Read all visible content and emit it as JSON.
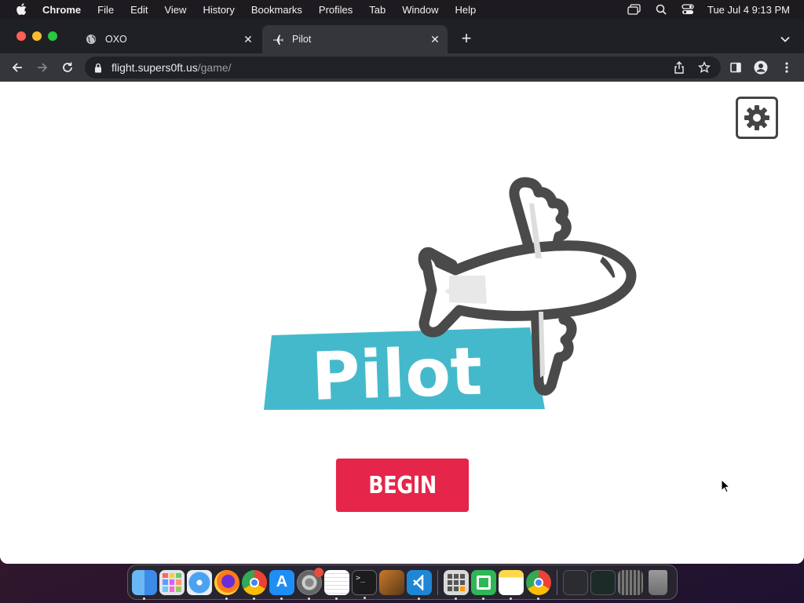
{
  "menubar": {
    "app_name": "Chrome",
    "items": [
      "File",
      "Edit",
      "View",
      "History",
      "Bookmarks",
      "Profiles",
      "Tab",
      "Window",
      "Help"
    ],
    "clock": "Tue Jul 4  9:13 PM"
  },
  "tabs": [
    {
      "title": "OXO",
      "active": false,
      "icon": "globe-icon"
    },
    {
      "title": "Pilot",
      "active": true,
      "icon": "airplane-icon"
    }
  ],
  "address_bar": {
    "host": "flight.supers0ft.us",
    "path": "/game/"
  },
  "page": {
    "logo_text": "Pilot",
    "begin_label": "BEGIN",
    "colors": {
      "banner": "#45b9cc",
      "button": "#e5254a",
      "outline": "#4a4a4a"
    }
  },
  "dock": {
    "apps": [
      "finder",
      "launchpad",
      "safari",
      "firefox",
      "chrome",
      "app-store",
      "system-settings",
      "textedit",
      "terminal",
      "garageband",
      "vscode",
      "calculator",
      "numbers",
      "notes",
      "chrome-2",
      "window-1",
      "window-2",
      "window-3",
      "trash"
    ]
  }
}
